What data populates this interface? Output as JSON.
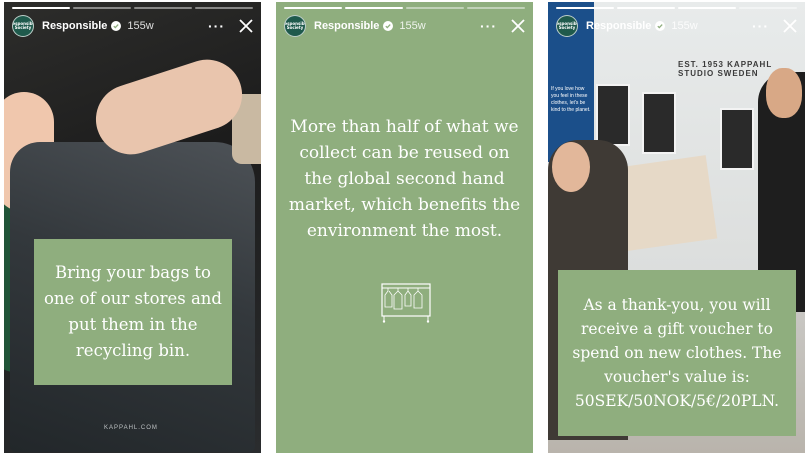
{
  "stories": [
    {
      "progress": [
        1,
        0,
        0,
        0
      ],
      "account": {
        "name": "Responsible",
        "age": "155w",
        "avatar_text": "Responsible Society"
      },
      "caption": "Bring your bags to one of our stores and put them in the recycling bin.",
      "bag_label": "KAPPAHL.COM"
    },
    {
      "progress": [
        1,
        1,
        0,
        0
      ],
      "account": {
        "name": "Responsible",
        "age": "155w",
        "avatar_text": "Responsible Society"
      },
      "caption": "More than half of what we collect can be reused on the global second hand market, which benefits the environment the most."
    },
    {
      "progress": [
        1,
        1,
        1,
        0
      ],
      "account": {
        "name": "Responsible",
        "age": "155w",
        "avatar_text": "Responsible Society"
      },
      "caption": "As a thank-you, you will receive a gift voucher to spend on new clothes. The voucher's value is: 50SEK/50NOK/5€/20PLN.",
      "store_sign": "EST. 1953 KAPPAHL STUDIO SWEDEN",
      "side_sign": "If you love how you feel in these clothes, let's be kind to the planet."
    }
  ],
  "icons": {
    "verified": "verified-badge-icon",
    "more": "more-options-icon",
    "close": "close-icon",
    "rack": "clothes-rack-icon"
  },
  "colors": {
    "brand_green": "#8fae7e",
    "avatar_green": "#1f5a4c"
  }
}
